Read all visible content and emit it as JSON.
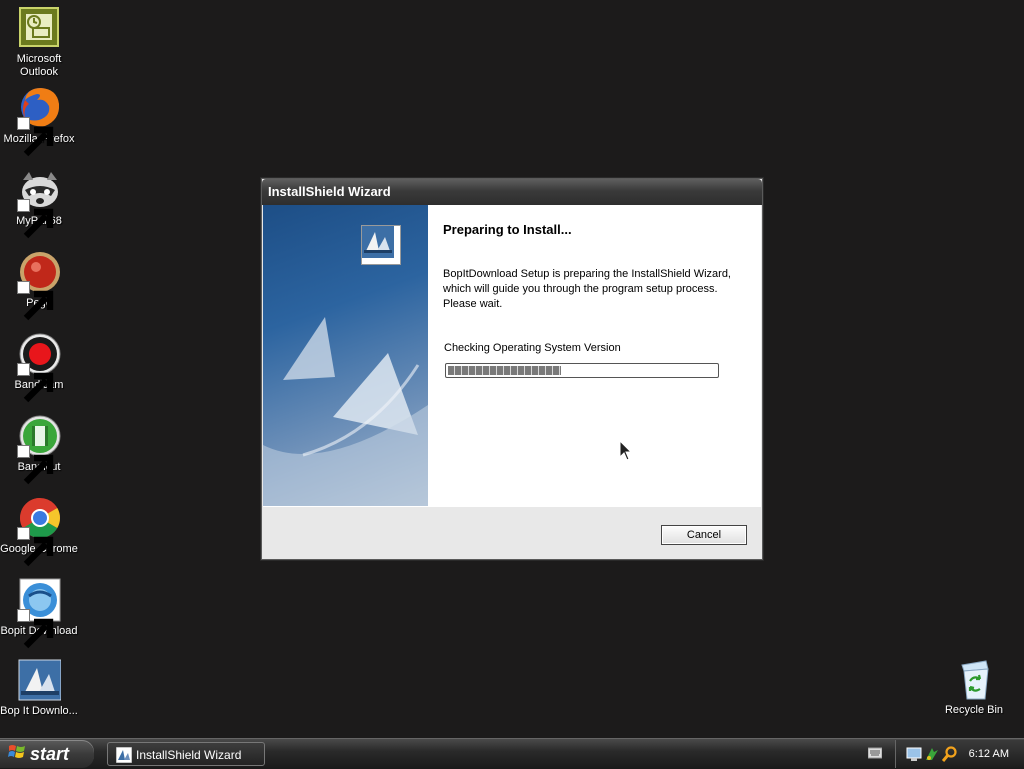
{
  "desktop": {
    "icons": [
      {
        "label": "Microsoft Outlook",
        "icon": "outlook-icon"
      },
      {
        "label": "Mozilla Firefox",
        "icon": "firefox-icon"
      },
      {
        "label": "MyPal 68",
        "icon": "mypal-icon"
      },
      {
        "label": "Pego",
        "icon": "pego-icon"
      },
      {
        "label": "Bandicam",
        "icon": "bandicam-icon"
      },
      {
        "label": "Bandicut",
        "icon": "bandicut-icon"
      },
      {
        "label": "Google Chrome",
        "icon": "chrome-icon"
      },
      {
        "label": "Bopit Download",
        "icon": "bopit-download-icon"
      },
      {
        "label": "Bop It Downlo...",
        "icon": "installshield-icon"
      }
    ],
    "recycle_bin": {
      "label": "Recycle Bin",
      "icon": "recycle-bin-icon"
    }
  },
  "dialog": {
    "title": "InstallShield Wizard",
    "heading": "Preparing to Install...",
    "description": "BopItDownload Setup is preparing the InstallShield Wizard, which will guide you through the program setup process.  Please wait.",
    "status": "Checking Operating System Version",
    "progress": 0.42,
    "cancel_label": "Cancel"
  },
  "taskbar": {
    "start_label": "start",
    "task_item": "InstallShield Wizard",
    "clock": "6:12 AM"
  },
  "colors": {
    "desktop": "#1c1b1b",
    "titlebar": "#3a3a3a",
    "side_panel": "#2c64a0"
  }
}
